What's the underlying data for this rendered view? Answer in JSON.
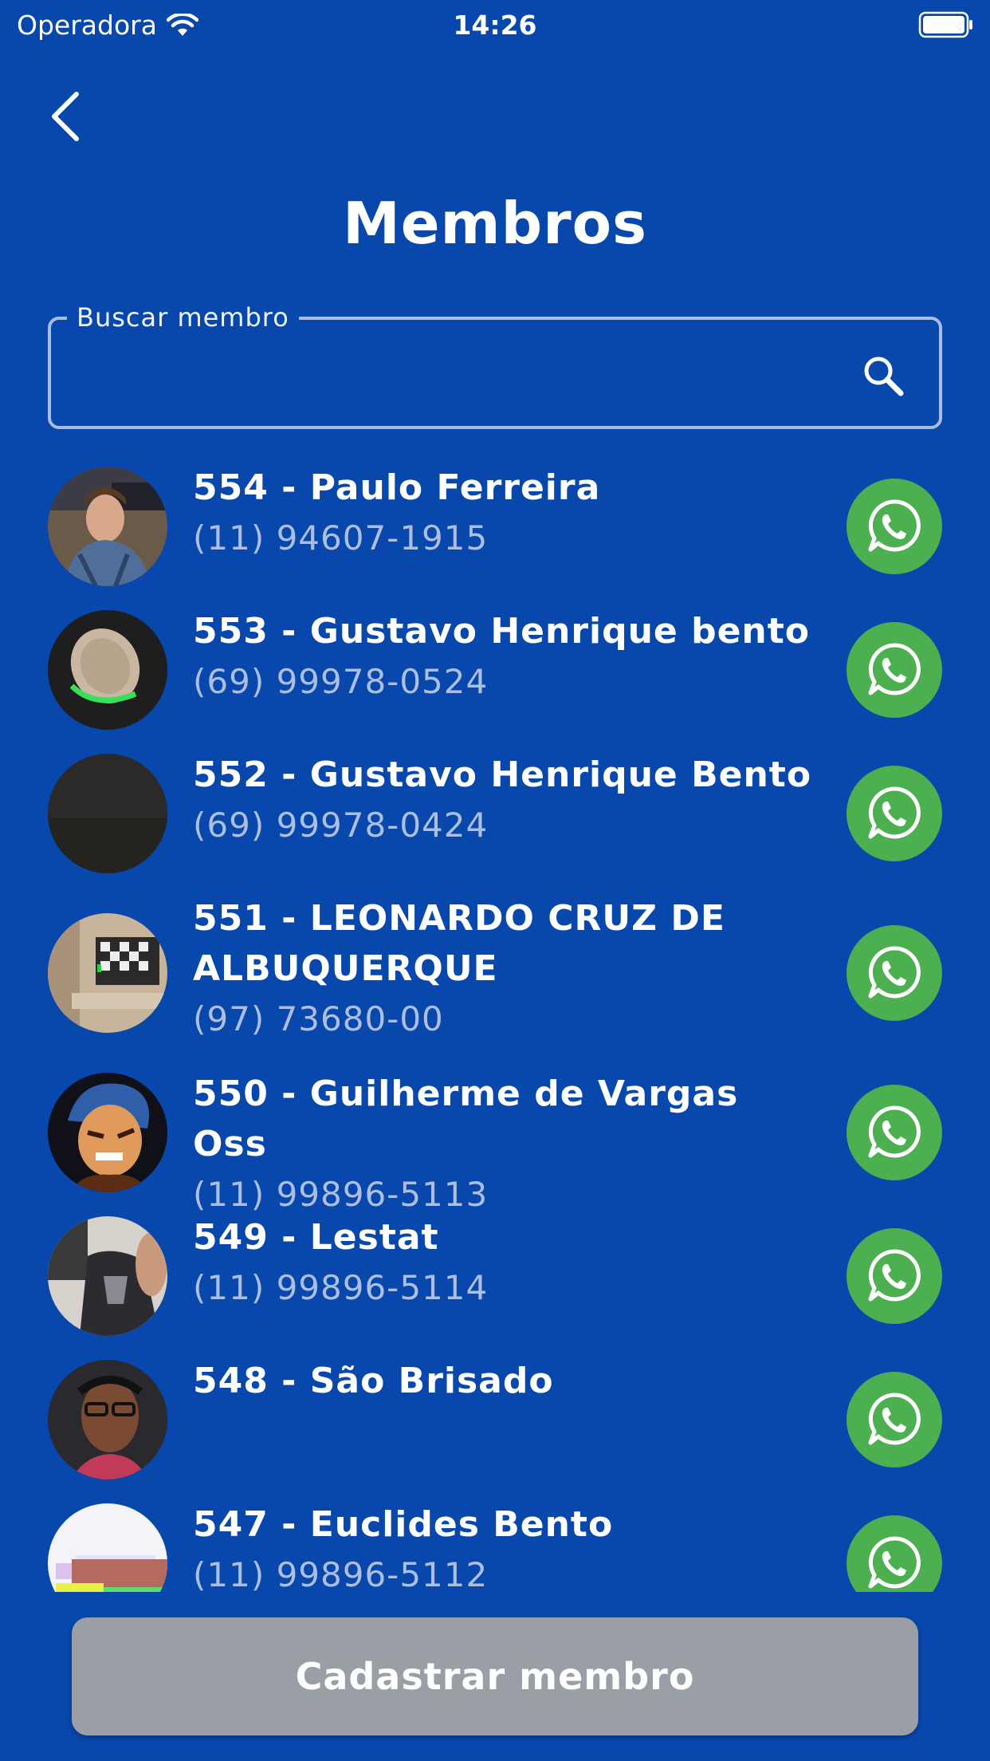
{
  "status_bar": {
    "carrier": "Operadora",
    "time": "14:26"
  },
  "header": {
    "title": "Membros"
  },
  "search": {
    "label": "Buscar membro",
    "value": "",
    "placeholder": ""
  },
  "members": [
    {
      "name": "554 - Paulo Ferreira",
      "phone": "(11) 94607-1915"
    },
    {
      "name": "553 - Gustavo Henrique bento",
      "phone": "(69) 99978-0524"
    },
    {
      "name": "552 - Gustavo Henrique Bento",
      "phone": "(69) 99978-0424"
    },
    {
      "name": "551 - LEONARDO CRUZ DE ALBUQUERQUE",
      "phone": "(97) 73680-00"
    },
    {
      "name": "550 - Guilherme de Vargas Oss",
      "phone": "(11) 99896-5113"
    },
    {
      "name": "549 - Lestat",
      "phone": "(11) 99896-5114"
    },
    {
      "name": "548 - São Brisado",
      "phone": ""
    },
    {
      "name": "547 - Euclides Bento",
      "phone": "(11) 99896-5112"
    }
  ],
  "footer": {
    "register_label": "Cadastrar membro"
  },
  "colors": {
    "background": "#0847ab",
    "whatsapp": "#4caf50",
    "button_disabled": "#9a9ea5"
  }
}
